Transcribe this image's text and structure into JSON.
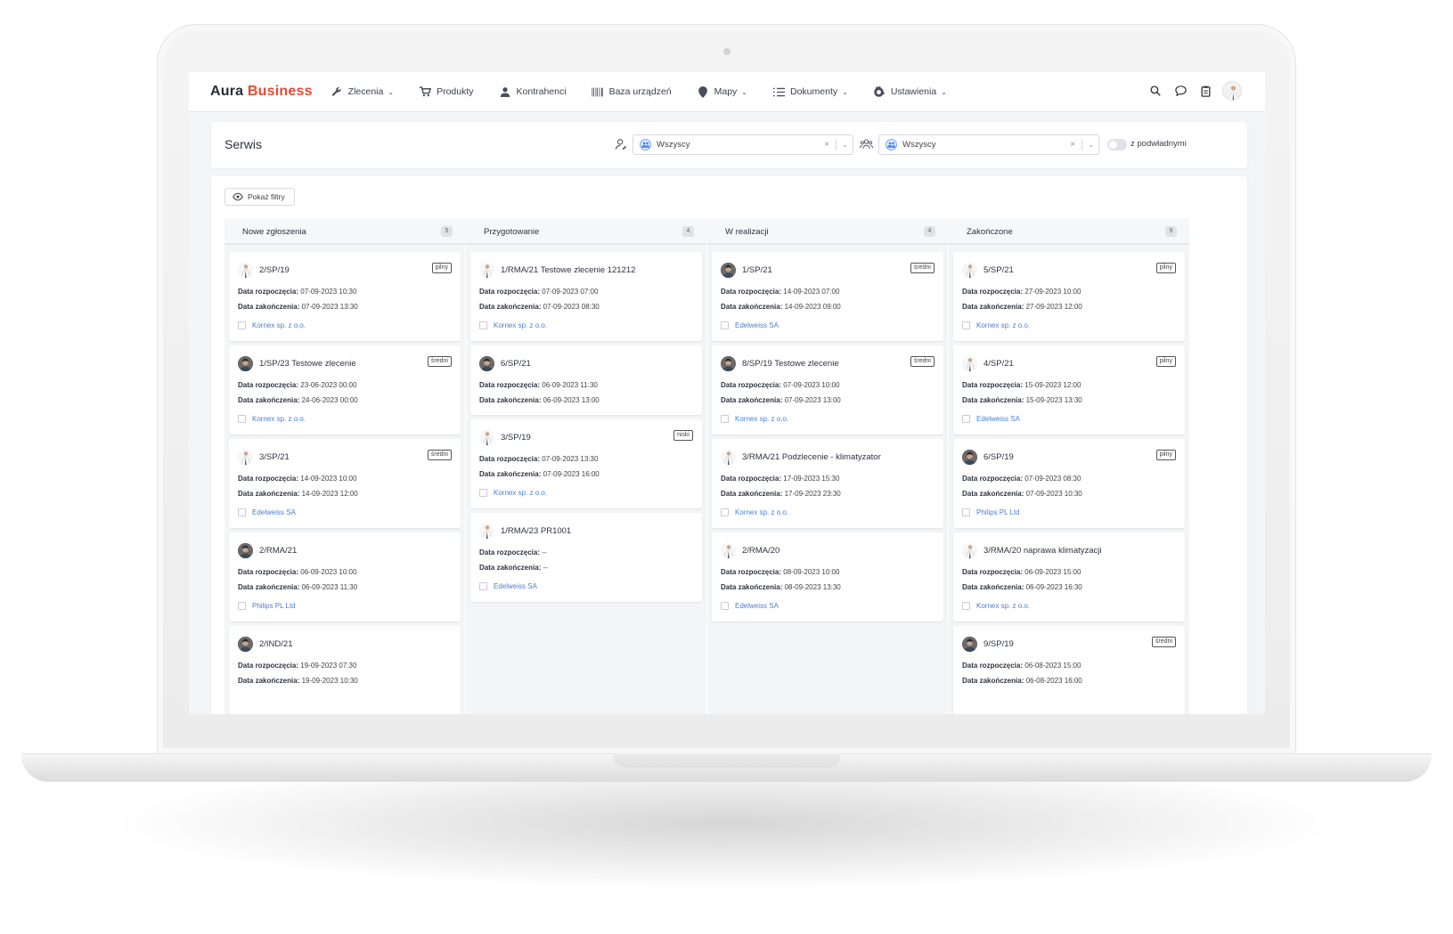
{
  "brand": {
    "name": "Aura",
    "accent": "Business"
  },
  "nav": [
    {
      "label": "Zlecenia",
      "icon": "wrench-icon",
      "dropdown": true
    },
    {
      "label": "Produkty",
      "icon": "cart-icon",
      "dropdown": false
    },
    {
      "label": "Kontrahenci",
      "icon": "user-icon",
      "dropdown": false
    },
    {
      "label": "Baza urządzeń",
      "icon": "barcode-icon",
      "dropdown": false
    },
    {
      "label": "Mapy",
      "icon": "map-pin-icon",
      "dropdown": true
    },
    {
      "label": "Dokumenty",
      "icon": "list-icon",
      "dropdown": true
    },
    {
      "label": "Ustawienia",
      "icon": "gear-icon",
      "dropdown": true
    }
  ],
  "header": {
    "title": "Serwis",
    "filter1": {
      "value": "Wszyscy"
    },
    "filter2": {
      "value": "Wszyscy"
    },
    "toggle_label": "z podwładnymi"
  },
  "board": {
    "show_filters": "Pokaż filtry",
    "labels": {
      "start": "Data rozpoczęcia:",
      "end": "Data zakończenia:"
    },
    "columns": [
      {
        "name": "Nowe zgłoszenia",
        "count": "5",
        "cards": [
          {
            "title": "2/SP/19",
            "priority": "pilny",
            "start": "07-09-2023 10:30",
            "end": "07-09-2023 13:30",
            "client": "Kornex sp. z o.o.",
            "avatar": "person"
          },
          {
            "title": "1/SP/23 Testowe zlecenie",
            "priority": "średni",
            "start": "23-06-2023 00:00",
            "end": "24-06-2023 00:00",
            "client": "Kornex sp. z o.o.",
            "avatar": "photo"
          },
          {
            "title": "3/SP/21",
            "priority": "średni",
            "start": "14-09-2023 10:00",
            "end": "14-09-2023 12:00",
            "client": "Edelweiss SA",
            "avatar": "person"
          },
          {
            "title": "2/RMA/21",
            "priority": "",
            "start": "06-09-2023 10:00",
            "end": "06-09-2023 11:30",
            "client": "Philips PL Ltd",
            "avatar": "photo"
          },
          {
            "title": "2/IND/21",
            "priority": "",
            "start": "19-09-2023 07:30",
            "end": "19-09-2023 10:30",
            "client": "",
            "avatar": "photo"
          }
        ]
      },
      {
        "name": "Przygotowanie",
        "count": "4",
        "cards": [
          {
            "title": "1/RMA/21 Testowe zlecenie 121212",
            "priority": "",
            "start": "07-09-2023 07:00",
            "end": "07-09-2023 08:30",
            "client": "Kornex sp. z o.o.",
            "avatar": "person"
          },
          {
            "title": "6/SP/21",
            "priority": "",
            "start": "06-09-2023 11:30",
            "end": "06-09-2023 13:00",
            "client": "",
            "avatar": "photo"
          },
          {
            "title": "3/SP/19",
            "priority": "niski",
            "start": "07-09-2023 13:30",
            "end": "07-09-2023 16:00",
            "client": "Kornex sp. z o.o.",
            "avatar": "person"
          },
          {
            "title": "1/RMA/23 PR1001",
            "priority": "",
            "start": "--",
            "end": "--",
            "client": "Edelweiss SA",
            "avatar": "person"
          }
        ]
      },
      {
        "name": "W realizacji",
        "count": "4",
        "cards": [
          {
            "title": "1/SP/21",
            "priority": "średni",
            "start": "14-09-2023 07:00",
            "end": "14-09-2023 09:00",
            "client": "Edelweiss SA",
            "avatar": "photo"
          },
          {
            "title": "8/SP/19 Testowe zlecenie",
            "priority": "średni",
            "start": "07-09-2023 10:00",
            "end": "07-09-2023 13:00",
            "client": "Kornex sp. z o.o.",
            "avatar": "photo"
          },
          {
            "title": "3/RMA/21 Podzlecenie - klimatyzator",
            "priority": "",
            "start": "17-09-2023 15:30",
            "end": "17-09-2023 23:30",
            "client": "Kornex sp. z o.o.",
            "avatar": "person"
          },
          {
            "title": "2/RMA/20",
            "priority": "",
            "start": "08-09-2023 10:00",
            "end": "08-09-2023 13:30",
            "client": "Edelweiss SA",
            "avatar": "person"
          }
        ]
      },
      {
        "name": "Zakończone",
        "count": "9",
        "cards": [
          {
            "title": "5/SP/21",
            "priority": "pilny",
            "start": "27-09-2023 10:00",
            "end": "27-09-2023 12:00",
            "client": "Kornex sp. z o.o.",
            "avatar": "person"
          },
          {
            "title": "4/SP/21",
            "priority": "pilny",
            "start": "15-09-2023 12:00",
            "end": "15-09-2023 13:30",
            "client": "Edelweiss SA",
            "avatar": "person"
          },
          {
            "title": "6/SP/19",
            "priority": "pilny",
            "start": "07-09-2023 08:30",
            "end": "07-09-2023 10:30",
            "client": "Philips PL Ltd",
            "avatar": "photo"
          },
          {
            "title": "3/RMA/20 naprawa klimatyzacji",
            "priority": "",
            "start": "06-09-2023 15:00",
            "end": "06-09-2023 16:30",
            "client": "Kornex sp. z o.o.",
            "avatar": "person"
          },
          {
            "title": "9/SP/19",
            "priority": "średni",
            "start": "06-08-2023 15:00",
            "end": "06-08-2023 16:00",
            "client": "",
            "avatar": "photo"
          }
        ]
      }
    ]
  },
  "colors": {
    "accent": "#e64a35",
    "link": "#4a7fd1",
    "background": "#f4f5f7"
  }
}
